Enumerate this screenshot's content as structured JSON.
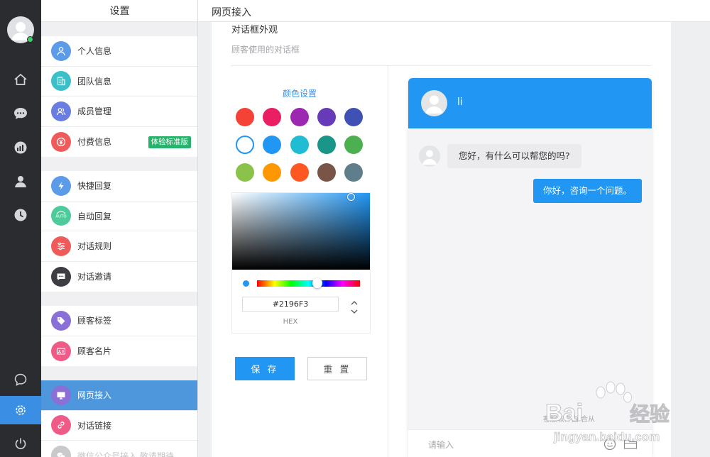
{
  "sidebar": {
    "title": "设置",
    "groups": [
      [
        {
          "label": "个人信息",
          "icon": "person-icon",
          "color": "#5b9be8"
        },
        {
          "label": "团队信息",
          "icon": "building-icon",
          "color": "#3bbfc9"
        },
        {
          "label": "成员管理",
          "icon": "users-icon",
          "color": "#6a7de0"
        },
        {
          "label": "付费信息",
          "icon": "yen-icon",
          "color": "#ef5b5b",
          "badge": "体验标准版"
        }
      ],
      [
        {
          "label": "快捷回复",
          "icon": "lightning-icon",
          "color": "#5b9be8"
        },
        {
          "label": "自动回复",
          "icon": "auto-icon",
          "color": "#4ecb9a"
        },
        {
          "label": "对话规则",
          "icon": "rules-icon",
          "color": "#ef5b5b"
        },
        {
          "label": "对话邀请",
          "icon": "message-icon",
          "color": "#3c3e44"
        }
      ],
      [
        {
          "label": "顾客标签",
          "icon": "tag-icon",
          "color": "#8a6fd6"
        },
        {
          "label": "顾客名片",
          "icon": "card-icon",
          "color": "#ef5b86"
        }
      ],
      [
        {
          "label": "网页接入",
          "icon": "monitor-icon",
          "color": "#8a6fd6",
          "active": true
        },
        {
          "label": "对话链接",
          "icon": "link-icon",
          "color": "#ef5b86"
        },
        {
          "label": "微信公众号接入 敬请期待",
          "icon": "wechat-icon",
          "color": "#c9c9cc",
          "disabled": true
        }
      ]
    ]
  },
  "header": {
    "title": "网页接入"
  },
  "section": {
    "title": "对话框外观",
    "subtitle": "顾客使用的对话框"
  },
  "color_settings": {
    "title": "颜色设置",
    "swatches": [
      "#f44336",
      "#e91e63",
      "#9c27b0",
      "#673ab7",
      "#3f51b5",
      "#ffffff",
      "#2196f3",
      "#1fbcd3",
      "#1a9688",
      "#4caf50",
      "#8bc34a",
      "#ff9800",
      "#ff5722",
      "#795548",
      "#607d8b"
    ],
    "selected_index": 5,
    "hex_value": "#2196F3",
    "hex_label": "HEX"
  },
  "buttons": {
    "save": "保 存",
    "reset": "重 置"
  },
  "chat": {
    "agent_name": "li",
    "incoming": "您好，有什么可以帮您的吗?",
    "outgoing": "你好，咨询一个问题。",
    "powered_by": "客服软件由 合从",
    "input_placeholder": "请输入"
  },
  "watermark": {
    "brand": "Baidu经验",
    "url": "jingyan.baidu.com"
  }
}
